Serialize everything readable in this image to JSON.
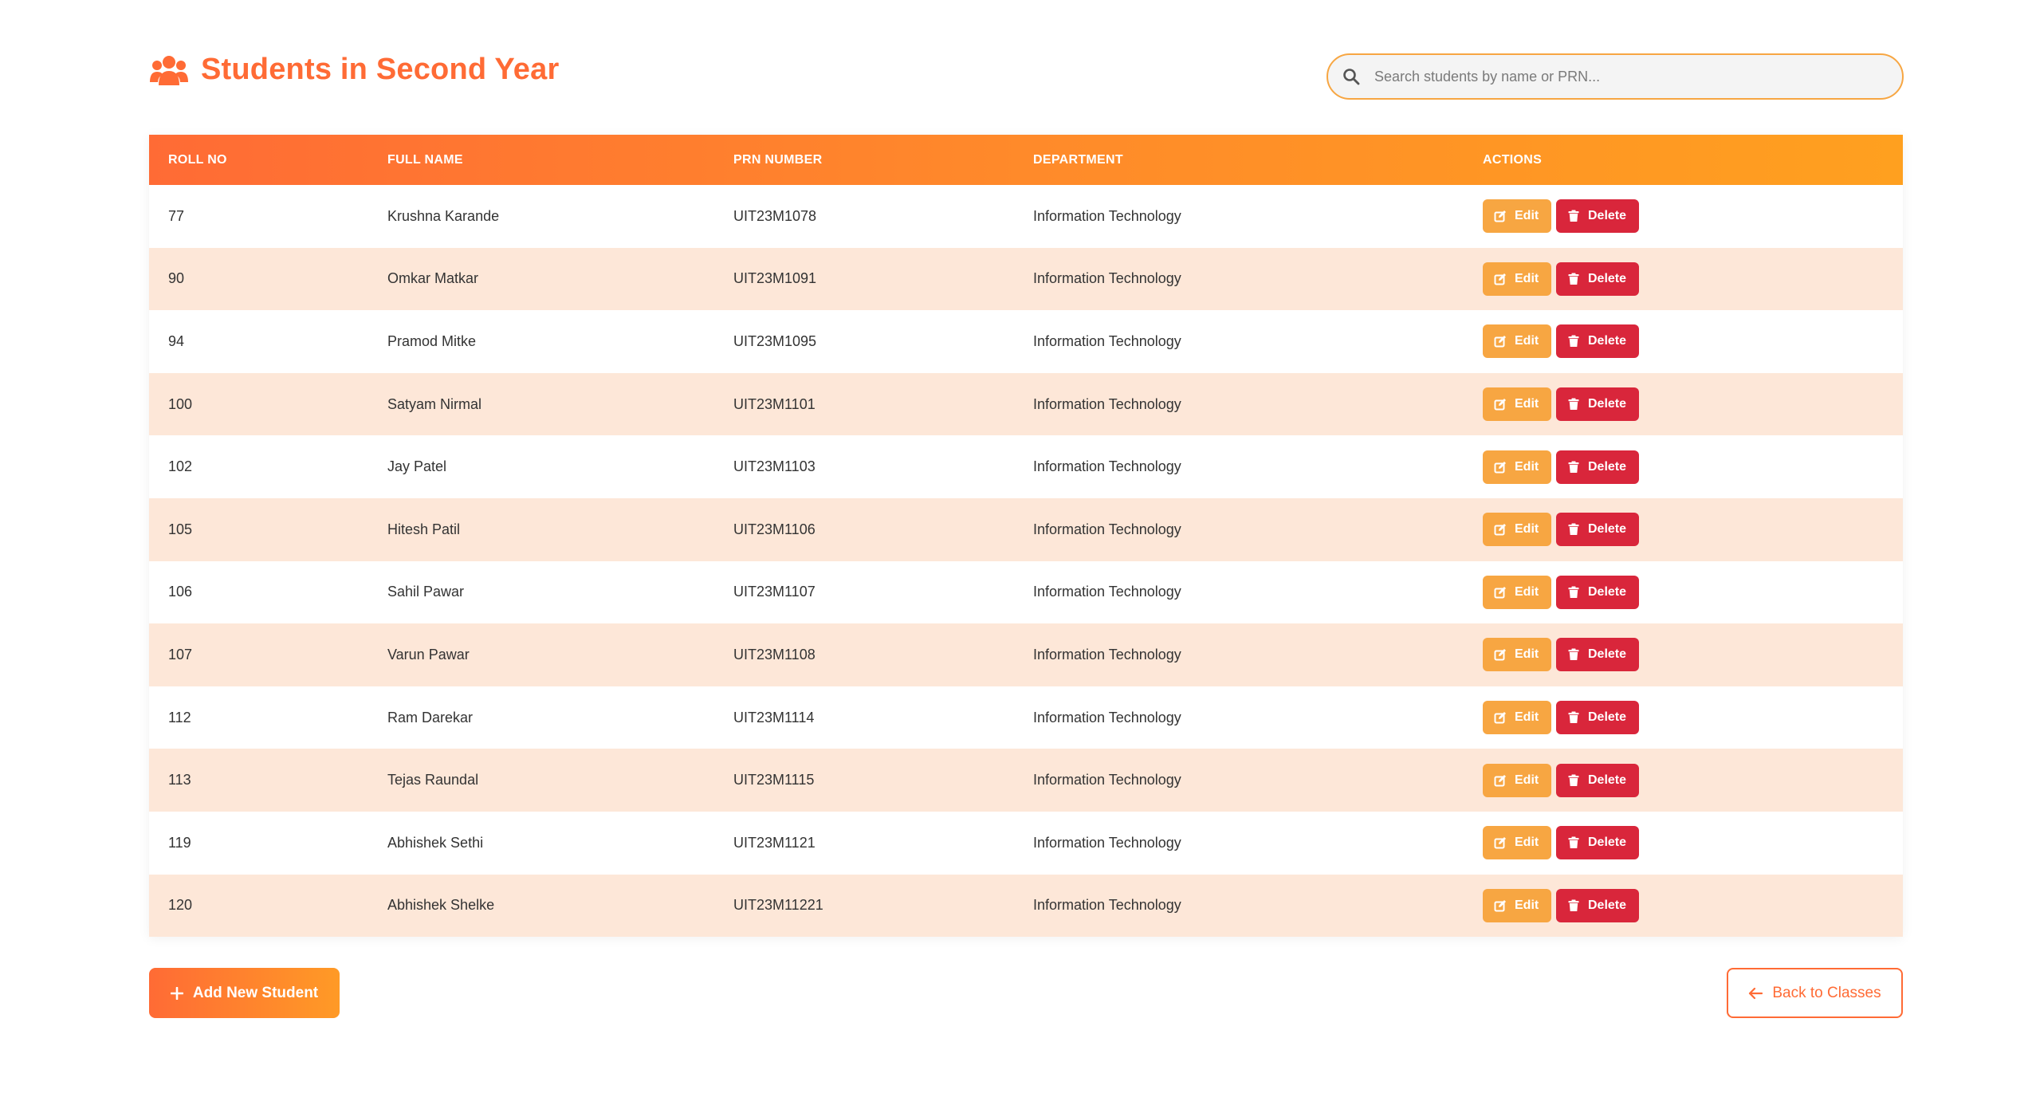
{
  "page": {
    "title": "Students in Second Year",
    "title_icon": "users-icon",
    "accent_color": "#ff6b35"
  },
  "search": {
    "placeholder": "Search students by name or PRN...",
    "value": ""
  },
  "table": {
    "headers": [
      "ROLL NO",
      "FULL NAME",
      "PRN NUMBER",
      "DEPARTMENT",
      "ACTIONS"
    ],
    "rows": [
      {
        "roll": "77",
        "name": "Krushna Karande",
        "prn": "UIT23M1078",
        "dept": "Information Technology"
      },
      {
        "roll": "90",
        "name": "Omkar Matkar",
        "prn": "UIT23M1091",
        "dept": "Information Technology"
      },
      {
        "roll": "94",
        "name": "Pramod Mitke",
        "prn": "UIT23M1095",
        "dept": "Information Technology"
      },
      {
        "roll": "100",
        "name": "Satyam Nirmal",
        "prn": "UIT23M1101",
        "dept": "Information Technology"
      },
      {
        "roll": "102",
        "name": "Jay Patel",
        "prn": "UIT23M1103",
        "dept": "Information Technology"
      },
      {
        "roll": "105",
        "name": "Hitesh Patil",
        "prn": "UIT23M1106",
        "dept": "Information Technology"
      },
      {
        "roll": "106",
        "name": "Sahil Pawar",
        "prn": "UIT23M1107",
        "dept": "Information Technology"
      },
      {
        "roll": "107",
        "name": "Varun Pawar",
        "prn": "UIT23M1108",
        "dept": "Information Technology"
      },
      {
        "roll": "112",
        "name": "Ram Darekar",
        "prn": "UIT23M1114",
        "dept": "Information Technology"
      },
      {
        "roll": "113",
        "name": "Tejas Raundal",
        "prn": "UIT23M1115",
        "dept": "Information Technology"
      },
      {
        "roll": "119",
        "name": "Abhishek Sethi",
        "prn": "UIT23M1121",
        "dept": "Information Technology"
      },
      {
        "roll": "120",
        "name": "Abhishek Shelke",
        "prn": "UIT23M11221",
        "dept": "Information Technology"
      }
    ],
    "edit_label": "Edit",
    "delete_label": "Delete",
    "edit_icon": "edit-icon",
    "delete_icon": "trash-icon",
    "colors": {
      "edit": "#f7a642",
      "delete": "#d9263b",
      "row_alt": "#fde7d8"
    }
  },
  "footer": {
    "add_label": "Add New Student",
    "add_icon": "plus-icon",
    "back_label": "Back to Classes",
    "back_icon": "arrow-left-icon"
  }
}
